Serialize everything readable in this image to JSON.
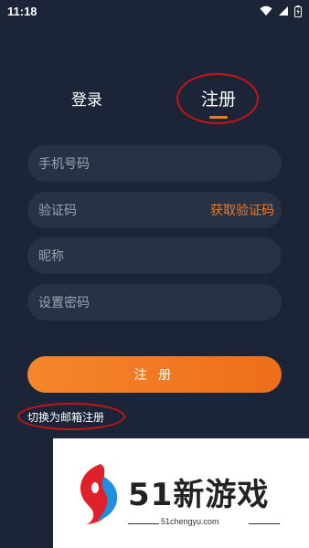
{
  "status_bar": {
    "time": "11:18"
  },
  "tabs": {
    "login": "登录",
    "register": "注册",
    "active": "register"
  },
  "form": {
    "phone_placeholder": "手机号码",
    "code_placeholder": "验证码",
    "get_code_label": "获取验证码",
    "nickname_placeholder": "昵称",
    "password_placeholder": "设置密码",
    "submit_label": "注 册",
    "switch_email_label": "切换为邮箱注册"
  },
  "watermark": {
    "brand_text": "51新游戏",
    "url": "51chengyu.com"
  },
  "colors": {
    "background": "#1c2537",
    "field_bg": "#283245",
    "accent": "#f07a22",
    "annotation": "#c81414"
  },
  "icons": [
    "wifi-icon",
    "signal-icon",
    "battery-icon"
  ]
}
